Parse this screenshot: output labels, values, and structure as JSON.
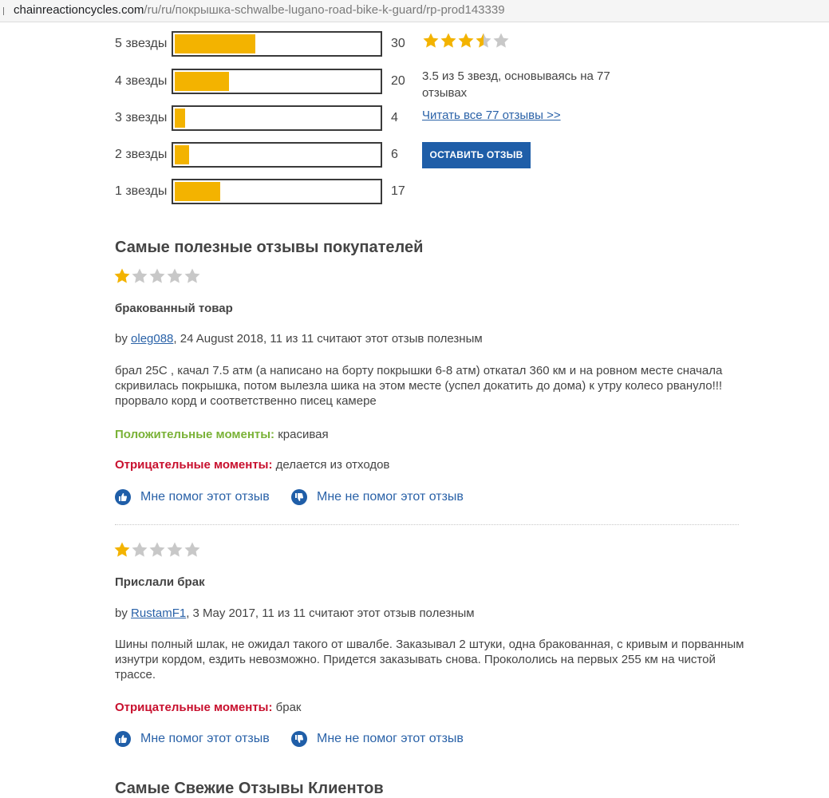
{
  "browser": {
    "url_domain": "chainreactioncycles.com",
    "url_path": "/ru/ru/покрышка-schwalbe-lugano-road-bike-k-guard/rp-prod143339"
  },
  "rating_summary": {
    "histogram": [
      {
        "label": "5 звезды",
        "count": "30",
        "fill_fraction": 0.39
      },
      {
        "label": "4 звезды",
        "count": "20",
        "fill_fraction": 0.26
      },
      {
        "label": "3 звезды",
        "count": "4",
        "fill_fraction": 0.05
      },
      {
        "label": "2 звезды",
        "count": "6",
        "fill_fraction": 0.07
      },
      {
        "label": "1 звезды",
        "count": "17",
        "fill_fraction": 0.22
      }
    ],
    "average_stars": 3.5,
    "average_text": "3.5 из 5 звезд, основываясь на 77 отзывах",
    "read_all_link": "Читать все 77 отзывы >>",
    "leave_review_button": "ОСТАВИТЬ ОТЗЫВ"
  },
  "helpful_section": {
    "title": "Самые полезные отзывы покупателей",
    "reviews": [
      {
        "stars": 1,
        "title": "бракованный товар",
        "by": "by ",
        "author": "oleg088",
        "meta": ", 24 August 2018, 11 из 11 считают этот отзыв полезным",
        "body": "брал 25C , качал 7.5 атм (а написано на борту покрышки 6-8 атм) откатал 360 км и на ровном месте сначала скривилась покрышка, потом вылезла шика на этом месте (успел докатить до дома) к утру колесо рвануло!!! прорвало корд и соответственно писец камере",
        "pros_label": "Положительные моменты:",
        "pros": " красивая",
        "cons_label": "Отрицательные моменты:",
        "cons": " делается из отходов",
        "helpful_yes": "Мне помог этот отзыв",
        "helpful_no": "Мне не помог этот отзыв"
      },
      {
        "stars": 1,
        "title": "Прислали брак",
        "by": "by ",
        "author": "RustamF1",
        "meta": ", 3 May 2017, 11 из 11 считают этот отзыв полезным",
        "body": "Шины полный шлак, не ожидал такого от швалбе. Заказывал 2 штуки, одна бракованная, с кривым и порванным изнутри кордом, ездить невозможно. Придется заказывать снова. Прокололись на первых 255 км на чистой трассе.",
        "cons_label": "Отрицательные моменты:",
        "cons": " брак",
        "helpful_yes": "Мне помог этот отзыв",
        "helpful_no": "Мне не помог этот отзыв"
      }
    ]
  },
  "latest_section": {
    "title": "Самые Свежие Отзывы Клиентов"
  },
  "colors": {
    "star_filled": "#f3b300",
    "star_empty": "#c8c8c8",
    "link": "#2a62a8",
    "button": "#1f5ea8",
    "pros": "#7ab237",
    "cons": "#c8102e"
  },
  "icons": {
    "thumbs_up": "thumbs-up-icon",
    "thumbs_down": "thumbs-down-icon",
    "star": "star-icon"
  }
}
